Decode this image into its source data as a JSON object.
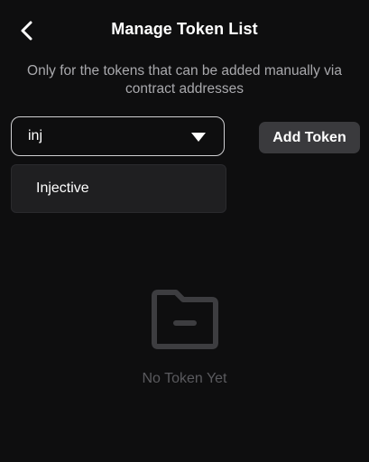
{
  "header": {
    "back_icon": "chevron-left-icon",
    "title": "Manage Token List"
  },
  "subtitle": "Only for the tokens that can be added manually via contract addresses",
  "search": {
    "value": "inj",
    "dropdown_icon": "caret-down-icon"
  },
  "add_button": {
    "label": "Add Token"
  },
  "dropdown": {
    "options": [
      {
        "label": "Injective"
      }
    ]
  },
  "empty_state": {
    "icon": "folder-icon",
    "text": "No Token Yet"
  },
  "colors": {
    "background": "#0e0e0f",
    "button_bg": "#3a3a3d",
    "dropdown_bg": "#1f1f21",
    "muted_text": "#a9a9ad",
    "empty_text": "#5a5a5e"
  }
}
